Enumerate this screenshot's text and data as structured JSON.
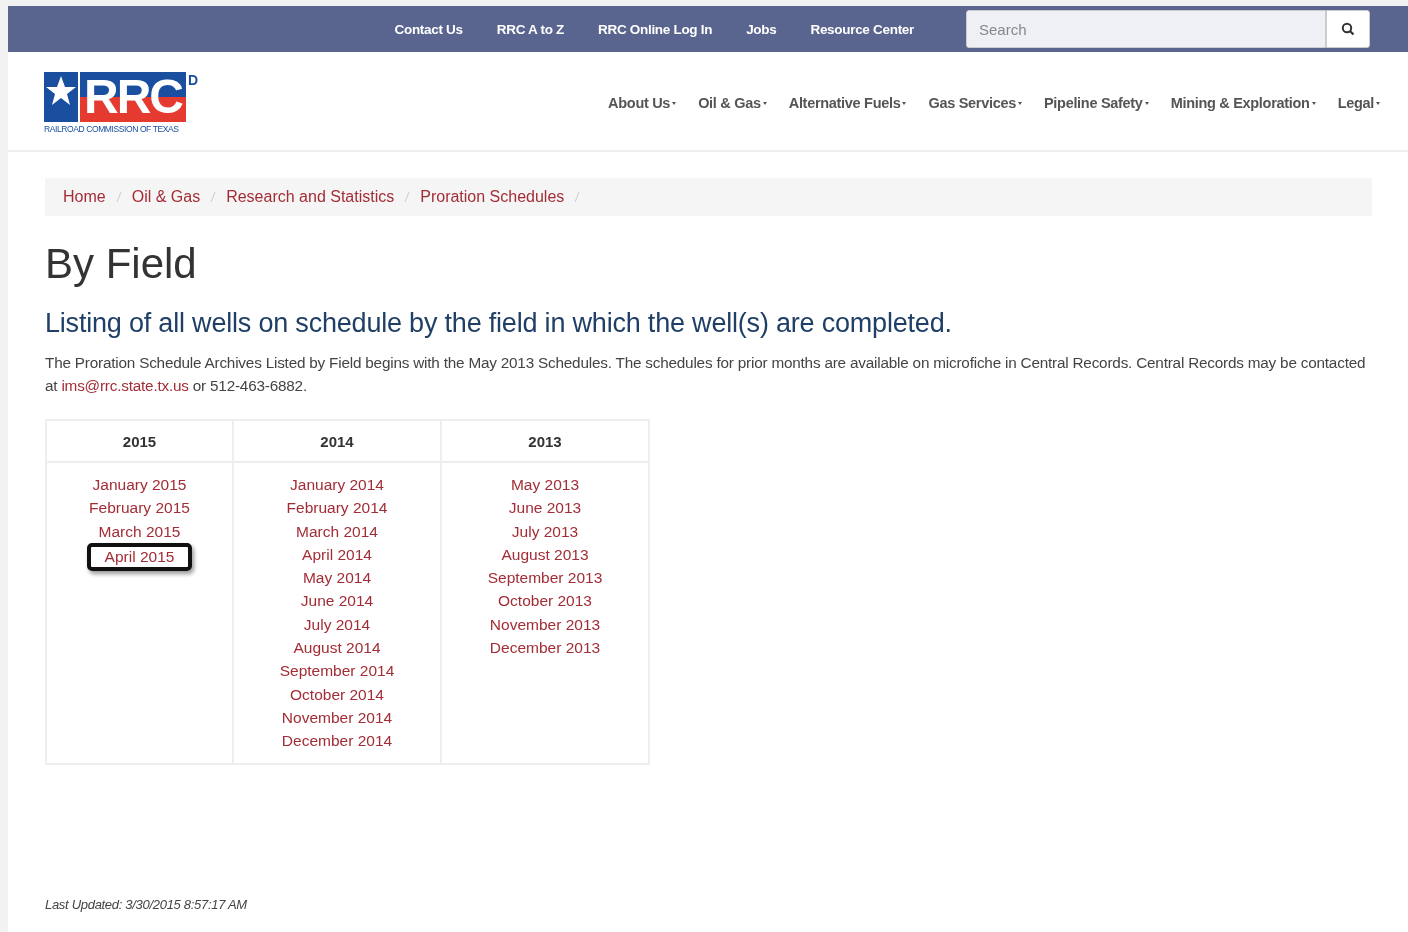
{
  "top_links": [
    "Contact Us",
    "RRC A to Z",
    "RRC Online Log In",
    "Jobs",
    "Resource Center"
  ],
  "search": {
    "placeholder": "Search"
  },
  "logo": {
    "letters": "RRC",
    "mark": "D",
    "caption": "RAILROAD COMMISSION OF TEXAS"
  },
  "main_nav": [
    "About Us",
    "Oil & Gas",
    "Alternative Fuels",
    "Gas Services",
    "Pipeline Safety",
    "Mining & Exploration",
    "Legal"
  ],
  "breadcrumb": [
    "Home",
    "Oil & Gas",
    "Research and Statistics",
    "Proration Schedules"
  ],
  "title": "By Field",
  "subtitle": "Listing of all wells on schedule by the field in which the well(s) are completed.",
  "intro": {
    "before": "The Proration Schedule Archives Listed by Field begins with the May 2013 Schedules. The schedules for prior months are available on microfiche in Central Records. Central Records may be contacted at ",
    "email": "ims@rrc.state.tx.us",
    "after": " or 512-463-6882."
  },
  "table": {
    "columns": [
      {
        "year": "2015",
        "months": [
          {
            "label": "January 2015",
            "highlighted": false
          },
          {
            "label": "February 2015",
            "highlighted": false
          },
          {
            "label": "March 2015",
            "highlighted": false
          },
          {
            "label": "April 2015",
            "highlighted": true
          }
        ]
      },
      {
        "year": "2014",
        "months": [
          {
            "label": "January 2014",
            "highlighted": false
          },
          {
            "label": "February 2014",
            "highlighted": false
          },
          {
            "label": "March 2014",
            "highlighted": false
          },
          {
            "label": "April 2014",
            "highlighted": false
          },
          {
            "label": "May 2014",
            "highlighted": false
          },
          {
            "label": "June 2014",
            "highlighted": false
          },
          {
            "label": "July 2014",
            "highlighted": false
          },
          {
            "label": "August 2014",
            "highlighted": false
          },
          {
            "label": "September 2014",
            "highlighted": false
          },
          {
            "label": "October 2014",
            "highlighted": false
          },
          {
            "label": "November 2014",
            "highlighted": false
          },
          {
            "label": "December 2014",
            "highlighted": false
          }
        ]
      },
      {
        "year": "2013",
        "months": [
          {
            "label": "May 2013",
            "highlighted": false
          },
          {
            "label": "June 2013",
            "highlighted": false
          },
          {
            "label": "July 2013",
            "highlighted": false
          },
          {
            "label": "August 2013",
            "highlighted": false
          },
          {
            "label": "September 2013",
            "highlighted": false
          },
          {
            "label": "October 2013",
            "highlighted": false
          },
          {
            "label": "November 2013",
            "highlighted": false
          },
          {
            "label": "December 2013",
            "highlighted": false
          }
        ]
      }
    ]
  },
  "last_updated": "Last Updated: 3/30/2015 8:57:17 AM"
}
